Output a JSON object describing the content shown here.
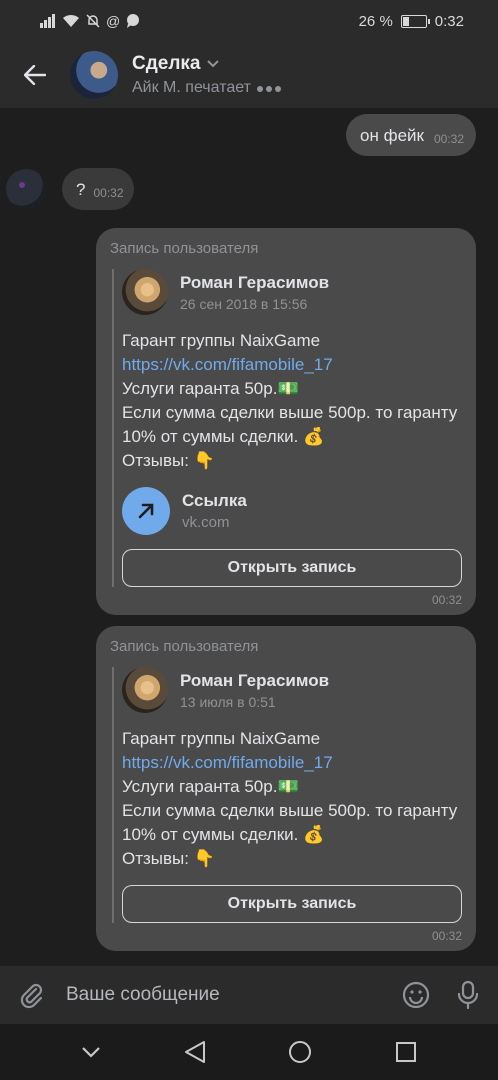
{
  "status": {
    "battery_text": "26 %",
    "battery_level": 0.26,
    "time": "0:32",
    "left_icons": [
      "signal-icon",
      "wifi-icon",
      "mute-icon",
      "at-icon",
      "chat-notification-icon"
    ]
  },
  "header": {
    "title": "Сделка",
    "subtitle": "Айк М. печатает"
  },
  "messages": {
    "outgoing_text": "он фейк",
    "outgoing_time": "00:32",
    "incoming_text": "?",
    "incoming_time": "00:32"
  },
  "posts": [
    {
      "header": "Запись пользователя",
      "author": "Роман Герасимов",
      "date": "26 сен 2018 в 15:56",
      "line1": "Гарант группы NaixGame",
      "link": "https://vk.com/fifamobile_17",
      "line3": "Услуги гаранта 50р.💵",
      "line4": "Если сумма сделки выше 500р. то гаранту 10% от суммы сделки. 💰",
      "line5": "Отзывы: 👇",
      "card_title": "Ссылка",
      "card_sub": "vk.com",
      "button": "Открыть запись",
      "time": "00:32"
    },
    {
      "header": "Запись пользователя",
      "author": "Роман Герасимов",
      "date": "13 июля в 0:51",
      "line1": "Гарант группы NaixGame",
      "link": "https://vk.com/fifamobile_17",
      "line3": "Услуги гаранта 50р.💵",
      "line4": "Если сумма сделки выше 500р. то гаранту 10% от суммы сделки. 💰",
      "line5": "Отзывы: 👇",
      "button": "Открыть запись",
      "time": "00:32"
    }
  ],
  "composer": {
    "placeholder": "Ваше сообщение"
  }
}
